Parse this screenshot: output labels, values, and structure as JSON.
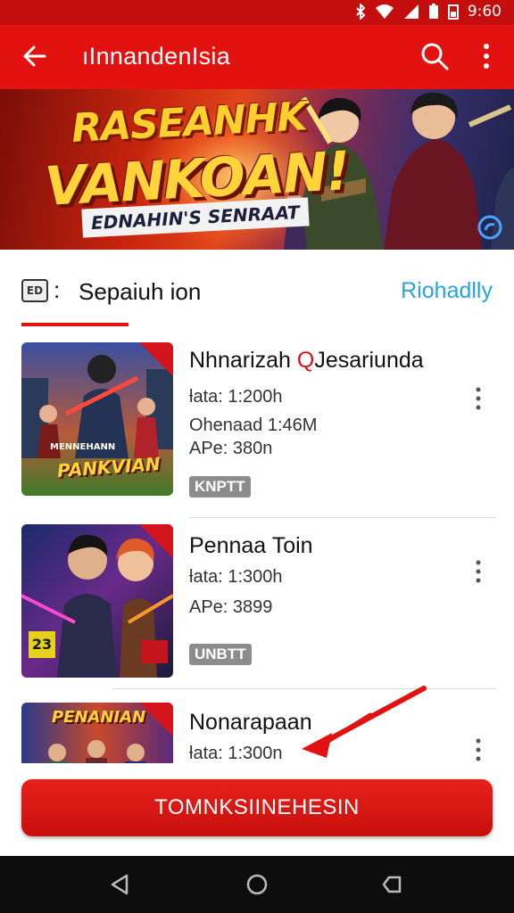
{
  "status_bar": {
    "time": "9:60"
  },
  "app_bar": {
    "title": "ıInnandenIsia"
  },
  "banner": {
    "line1": "RASEANHK",
    "line2": "VANKOAN!",
    "subtitle": "EDNAHIN'S SENRAAT"
  },
  "section": {
    "icon_label": "ED",
    "colon": ":",
    "title": "Sepaiuh ion",
    "link": "Riohadlly"
  },
  "items": [
    {
      "name": "Nhnarizah",
      "name_badge": "Q",
      "name_suffix": "Jesariunda",
      "meta": [
        "ƚata: 1:200h",
        "Ohenaad 1:46M",
        "APe: 380n"
      ],
      "tag": "KNPTT",
      "thumb_caption": "PANKVIAN",
      "thumb_caption_small": "MENNEHANN"
    },
    {
      "name": "Pennaa Toin",
      "meta": [
        "ƚata: 1:300h",
        "APe: 3899"
      ],
      "tag": "UNBTT",
      "thumb_badge": "23"
    },
    {
      "name": "Nonarapaan",
      "meta": [
        "ƚata: 1:300n"
      ],
      "thumb_caption": "PENANIAN"
    }
  ],
  "cta": {
    "label": "TOMNKSIINEHESIN"
  },
  "colors": {
    "primary": "#e1120f",
    "status_bar": "#c40d0d",
    "link": "#2aa4d8",
    "tag_bg": "#8c8c8c",
    "nav_bar": "#0d0d0d"
  },
  "icons": {
    "back": "arrow-left-icon",
    "search": "search-icon",
    "more": "more-vertical-icon",
    "item_menu": "more-vertical-icon",
    "nav_back": "triangle-back-icon",
    "nav_home": "circle-home-icon",
    "nav_recents": "recents-icon"
  }
}
